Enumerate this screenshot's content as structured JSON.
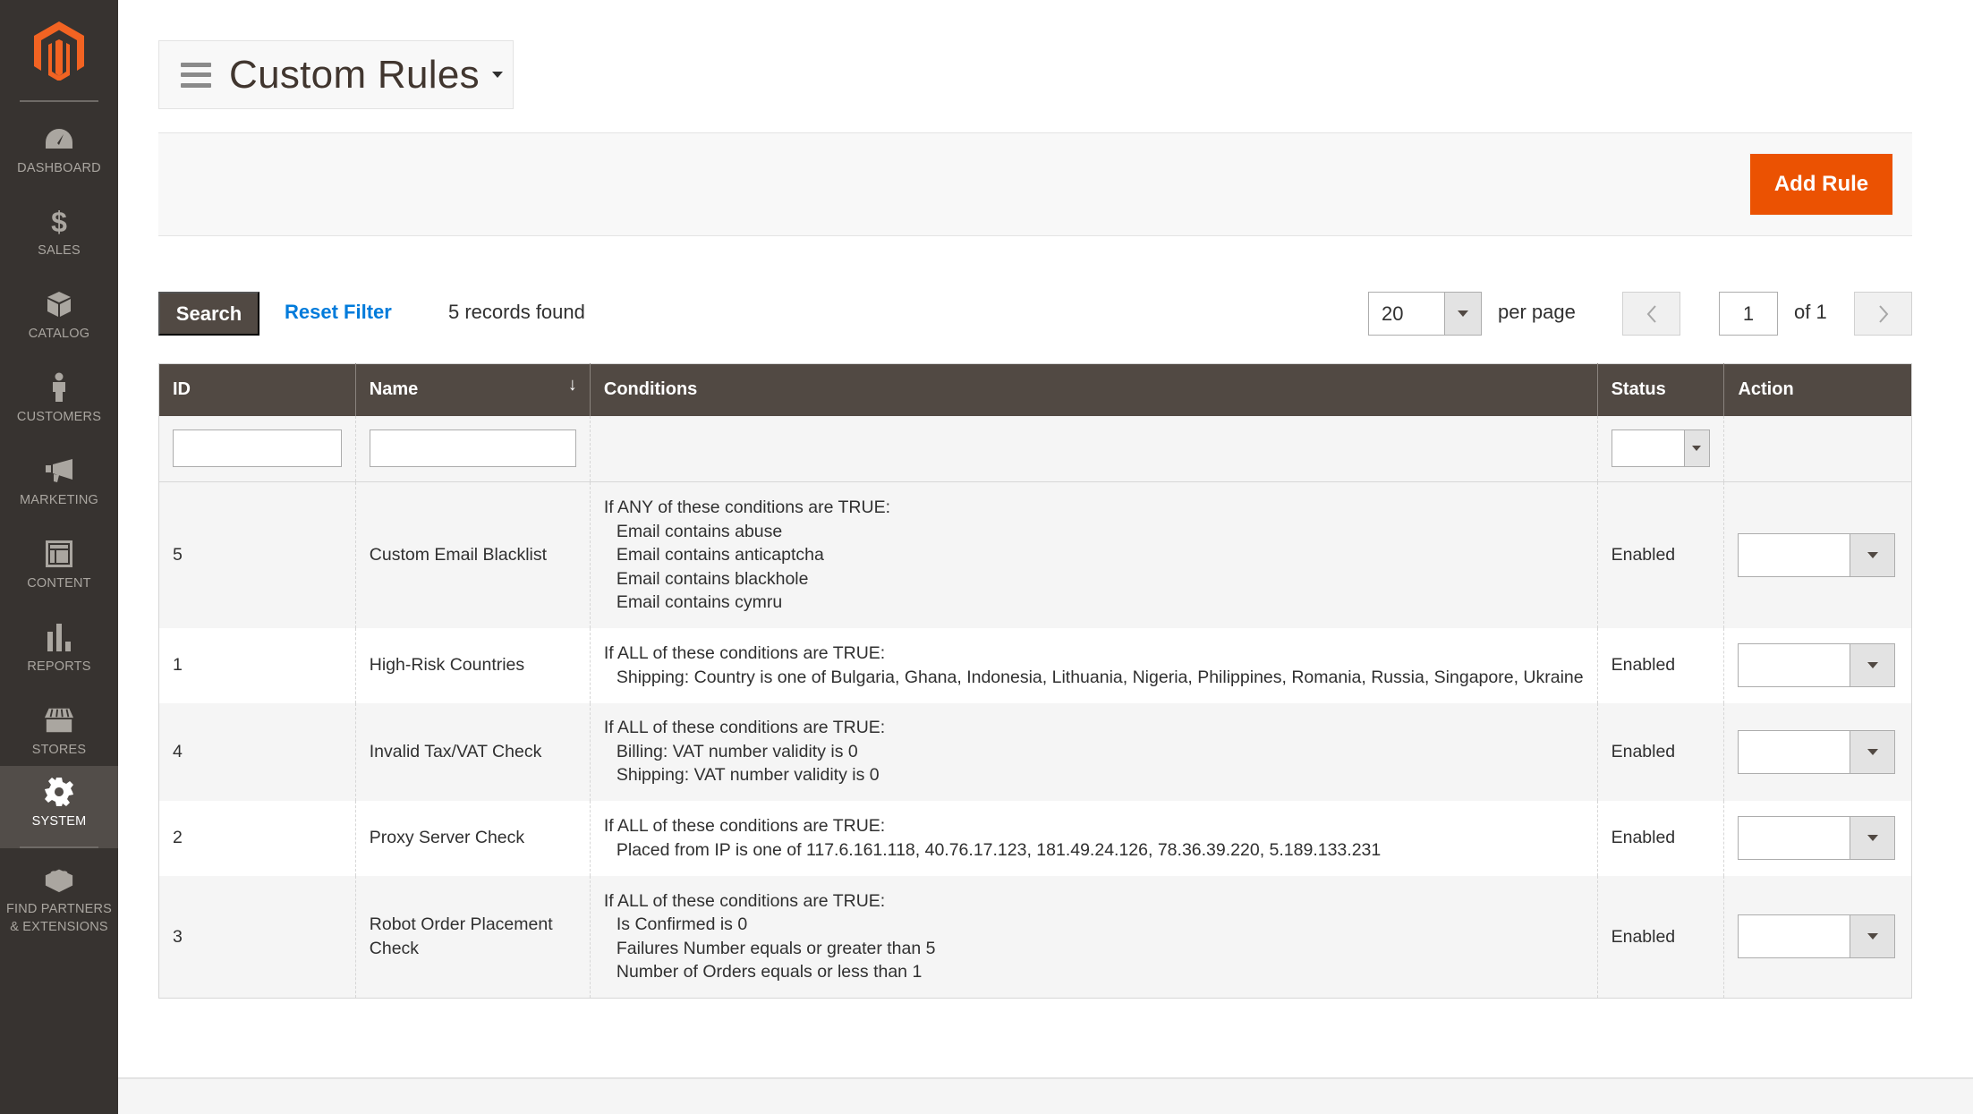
{
  "brand": {
    "logo_icon": "magento-logo-icon",
    "accent": "#eb5202"
  },
  "sidebar": {
    "items": [
      {
        "key": "dashboard",
        "label": "DASHBOARD",
        "icon": "dashboard-gauge-icon",
        "active": false
      },
      {
        "key": "sales",
        "label": "SALES",
        "icon": "dollar-icon",
        "active": false
      },
      {
        "key": "catalog",
        "label": "CATALOG",
        "icon": "box-icon",
        "active": false
      },
      {
        "key": "customers",
        "label": "CUSTOMERS",
        "icon": "person-icon",
        "active": false
      },
      {
        "key": "marketing",
        "label": "MARKETING",
        "icon": "megaphone-icon",
        "active": false
      },
      {
        "key": "content",
        "label": "CONTENT",
        "icon": "layout-icon",
        "active": false
      },
      {
        "key": "reports",
        "label": "REPORTS",
        "icon": "bar-chart-icon",
        "active": false
      },
      {
        "key": "stores",
        "label": "STORES",
        "icon": "storefront-icon",
        "active": false
      },
      {
        "key": "system",
        "label": "SYSTEM",
        "icon": "gear-icon",
        "active": true
      },
      {
        "key": "partners",
        "label": "FIND PARTNERS & EXTENSIONS",
        "icon": "lego-brick-icon",
        "active": false
      }
    ]
  },
  "header": {
    "title": "Custom Rules",
    "add_button_label": "Add Rule"
  },
  "toolbar": {
    "search_label": "Search",
    "reset_filter_label": "Reset Filter",
    "records_found": "5 records found",
    "per_page_value": "20",
    "per_page_label": "per page",
    "current_page": "1",
    "page_of": "of 1"
  },
  "grid": {
    "columns": [
      {
        "key": "id",
        "label": "ID"
      },
      {
        "key": "name",
        "label": "Name",
        "sorted": "desc"
      },
      {
        "key": "conditions",
        "label": "Conditions"
      },
      {
        "key": "status",
        "label": "Status"
      },
      {
        "key": "action",
        "label": "Action"
      }
    ],
    "filters": {
      "id": "",
      "name": "",
      "status": ""
    },
    "rows": [
      {
        "id": "5",
        "name": "Custom Email Blacklist",
        "conditions_header": "If ANY of these conditions are TRUE:",
        "conditions": [
          "Email contains abuse",
          "Email contains anticaptcha",
          "Email contains blackhole",
          "Email contains cymru"
        ],
        "status": "Enabled",
        "action": ""
      },
      {
        "id": "1",
        "name": "High-Risk Countries",
        "conditions_header": "If ALL of these conditions are TRUE:",
        "conditions": [
          "Shipping: Country is one of Bulgaria, Ghana, Indonesia, Lithuania, Nigeria, Philippines, Romania, Russia, Singapore, Ukraine"
        ],
        "status": "Enabled",
        "action": ""
      },
      {
        "id": "4",
        "name": "Invalid Tax/VAT Check",
        "conditions_header": "If ALL of these conditions are TRUE:",
        "conditions": [
          "Billing: VAT number validity is 0",
          "Shipping: VAT number validity is 0"
        ],
        "status": "Enabled",
        "action": ""
      },
      {
        "id": "2",
        "name": "Proxy Server Check",
        "conditions_header": "If ALL of these conditions are TRUE:",
        "conditions": [
          "Placed from IP is one of 117.6.161.118, 40.76.17.123, 181.49.24.126, 78.36.39.220, 5.189.133.231"
        ],
        "status": "Enabled",
        "action": ""
      },
      {
        "id": "3",
        "name": "Robot Order Placement Check",
        "conditions_header": "If ALL of these conditions are TRUE:",
        "conditions": [
          "Is Confirmed is 0",
          "Failures Number equals or greater than 5",
          "Number of Orders equals or less than 1"
        ],
        "status": "Enabled",
        "action": ""
      }
    ]
  }
}
